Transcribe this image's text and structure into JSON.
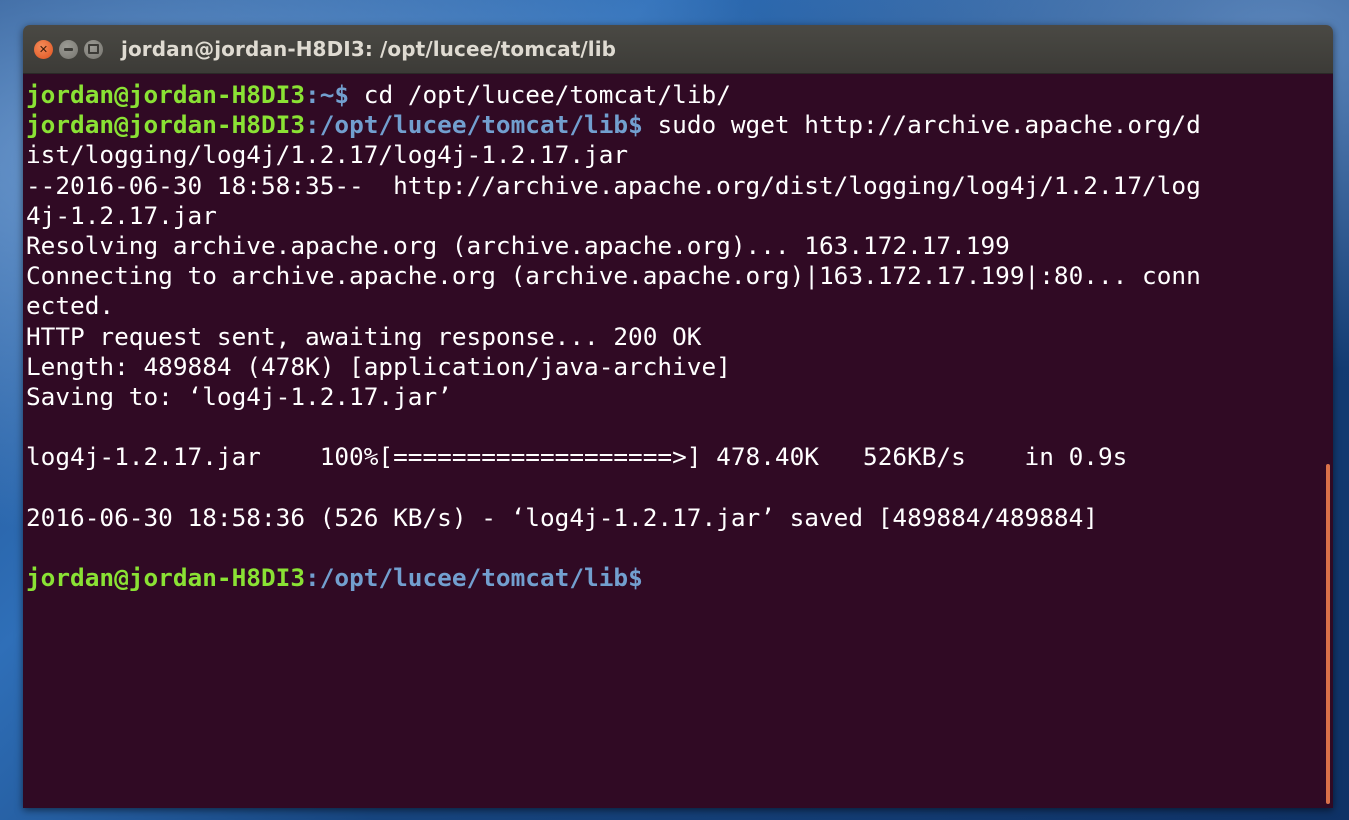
{
  "window": {
    "title": "jordan@jordan-H8DI3: /opt/lucee/tomcat/lib"
  },
  "colors": {
    "terminal_bg": "#300a24",
    "prompt_user": "#8ae234",
    "prompt_path": "#729fcf",
    "close_button": "#e0531f"
  },
  "icons": {
    "close": "close-icon",
    "minimize": "minimize-icon",
    "maximize": "maximize-icon"
  },
  "terminal": {
    "lines": [
      {
        "user": "jordan@jordan-H8DI3",
        "path": ":~$",
        "text": " cd /opt/lucee/tomcat/lib/"
      },
      {
        "user": "jordan@jordan-H8DI3",
        "path": ":/opt/lucee/tomcat/lib$",
        "text": " sudo wget http://archive.apache.org/d"
      },
      {
        "text": "ist/logging/log4j/1.2.17/log4j-1.2.17.jar"
      },
      {
        "text": "--2016-06-30 18:58:35--  http://archive.apache.org/dist/logging/log4j/1.2.17/log"
      },
      {
        "text": "4j-1.2.17.jar"
      },
      {
        "text": "Resolving archive.apache.org (archive.apache.org)... 163.172.17.199"
      },
      {
        "text": "Connecting to archive.apache.org (archive.apache.org)|163.172.17.199|:80... conn"
      },
      {
        "text": "ected."
      },
      {
        "text": "HTTP request sent, awaiting response... 200 OK"
      },
      {
        "text": "Length: 489884 (478K) [application/java-archive]"
      },
      {
        "text": "Saving to: ‘log4j-1.2.17.jar’"
      },
      {
        "text": ""
      },
      {
        "text": "log4j-1.2.17.jar    100%[===================>] 478.40K   526KB/s    in 0.9s"
      },
      {
        "text": ""
      },
      {
        "text": "2016-06-30 18:58:36 (526 KB/s) - ‘log4j-1.2.17.jar’ saved [489884/489884]"
      },
      {
        "text": ""
      },
      {
        "user": "jordan@jordan-H8DI3",
        "path": ":/opt/lucee/tomcat/lib$",
        "text": ""
      }
    ]
  }
}
